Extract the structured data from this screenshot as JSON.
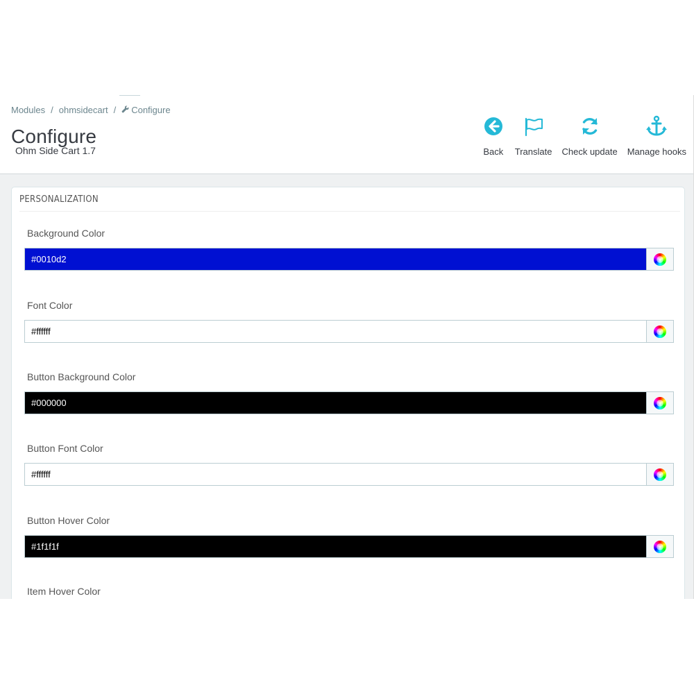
{
  "breadcrumb": {
    "items": [
      "Modules",
      "ohmsidecart",
      "Configure"
    ],
    "separator": "/"
  },
  "header": {
    "title": "Configure",
    "subtitle": "Ohm Side Cart 1.7"
  },
  "toolbar": {
    "accent_color": "#25b9d7",
    "buttons": [
      {
        "label": "Back",
        "icon": "back-arrow-icon"
      },
      {
        "label": "Translate",
        "icon": "flag-icon"
      },
      {
        "label": "Check update",
        "icon": "refresh-icon"
      },
      {
        "label": "Manage hooks",
        "icon": "anchor-icon"
      }
    ]
  },
  "panel": {
    "heading": "PERSONALIZATION",
    "fields": [
      {
        "label": "Background Color",
        "value": "#0010d2",
        "bg": "#0010d2",
        "fg": "#ffffff"
      },
      {
        "label": "Font Color",
        "value": "#ffffff",
        "bg": "#ffffff",
        "fg": "#000000"
      },
      {
        "label": "Button Background Color",
        "value": "#000000",
        "bg": "#000000",
        "fg": "#ffffff"
      },
      {
        "label": "Button Font Color",
        "value": "#ffffff",
        "bg": "#ffffff",
        "fg": "#000000"
      },
      {
        "label": "Button Hover Color",
        "value": "#1f1f1f",
        "bg": "#000000",
        "fg": "#ffffff"
      },
      {
        "label": "Item Hover Color",
        "value": "",
        "bg": "#ffffff",
        "fg": "#000000"
      }
    ]
  }
}
